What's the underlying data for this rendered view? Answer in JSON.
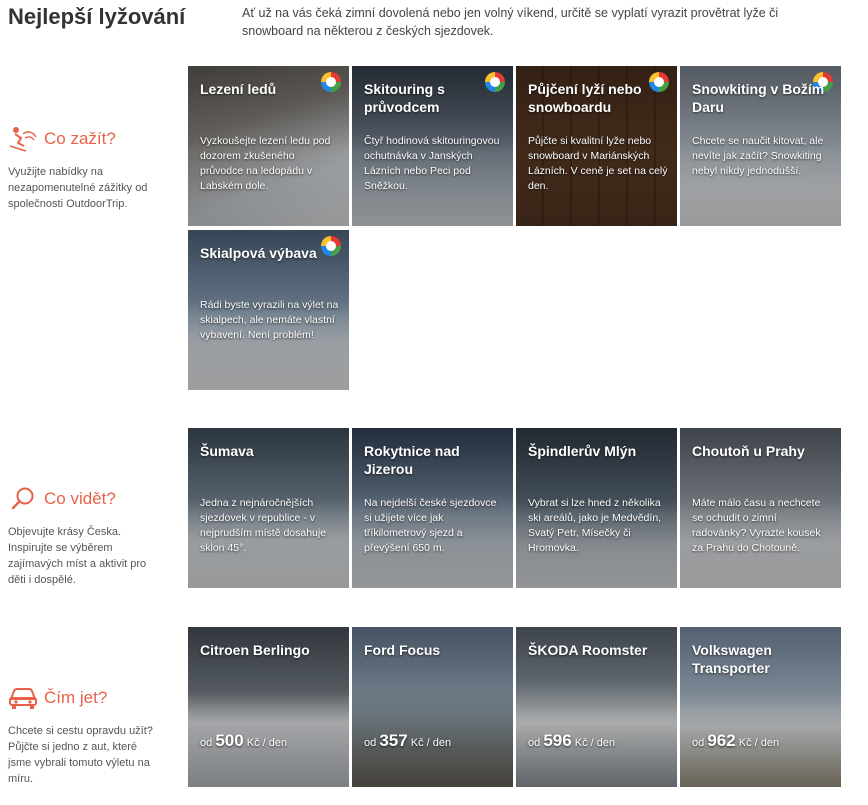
{
  "header": {
    "title": "Nejlepší lyžování",
    "intro": "Ať už na vás čeká zimní dovolená nebo jen volný víkend, určitě se vyplatí vyrazit provětrat lyže či snowboard na některou z českých sjezdovek."
  },
  "sections": {
    "experience": {
      "title": "Co zažít?",
      "icon": "skier-icon",
      "description": "Využijte nabídky na nezapomenutelné zážitky od společnosti OutdoorTrip.",
      "tiles": [
        {
          "title": "Lezení ledů",
          "text": "Vyzkoušejte lezení ledu pod dozorem zkušeného průvodce na ledopádu v Labském dole."
        },
        {
          "title": "Skitouring s průvodcem",
          "text": "Čtyř hodinová skitouringovou ochutnávka v Janských Lázních nebo Peci pod Sněžkou."
        },
        {
          "title": "Půjčení lyží nebo snowboardu",
          "text": "Půjčte si kvalitní lyže nebo snowboard v Mariánských Lázních. V ceně je set na celý den."
        },
        {
          "title": "Snowkiting v Božím Daru",
          "text": "Chcete se naučit kitovat, ale nevíte jak začít? Snowkiting nebyl nikdy jednodušší."
        },
        {
          "title": "Skialpová výbava",
          "text": "Rádi byste vyrazili na výlet na skialpech, ale nemáte vlastní vybavení. Není problém!"
        }
      ]
    },
    "see": {
      "title": "Co vidět?",
      "icon": "search-icon",
      "description": "Objevujte krásy Česka. Inspirujte se výběrem zajímavých míst a aktivit pro děti i dospělé.",
      "tiles": [
        {
          "title": "Šumava",
          "text": "Jedna z nejnáročnějších sjezdovek v republice - v nejprudším místě dosahuje sklon 45°."
        },
        {
          "title": "Rokytnice nad Jizerou",
          "text": "Na nejdelší české sjezdovce si užijete více jak tříkilometrový sjezd a převýšení 650 m."
        },
        {
          "title": "Špindlerův Mlýn",
          "text": "Vybrat si lze hned z několika ski areálů, jako je Medvědín, Svatý Petr, Mísečky či Hromovka."
        },
        {
          "title": "Choutoň u Prahy",
          "text": "Máte málo času a nechcete se ochudit o zimní radovánky? Vyrazte kousek za Prahu do Chotouně."
        }
      ]
    },
    "ride": {
      "title": "Čím jet?",
      "icon": "car-icon",
      "description": "Chcete si cestu opravdu užít? Půjčte si jedno z aut, které jsme vybrali tomuto výletu na míru.",
      "price_prefix": "od",
      "price_suffix": "Kč / den",
      "tiles": [
        {
          "title": "Citroen Berlingo",
          "price": "500"
        },
        {
          "title": "Ford Focus",
          "price": "357"
        },
        {
          "title": "ŠKODA Roomster",
          "price": "596"
        },
        {
          "title": "Volkswagen Transporter",
          "price": "962"
        }
      ]
    }
  },
  "colors": {
    "accent": "#e8624a",
    "ring_icon": "outdoortrip-ring-icon"
  }
}
